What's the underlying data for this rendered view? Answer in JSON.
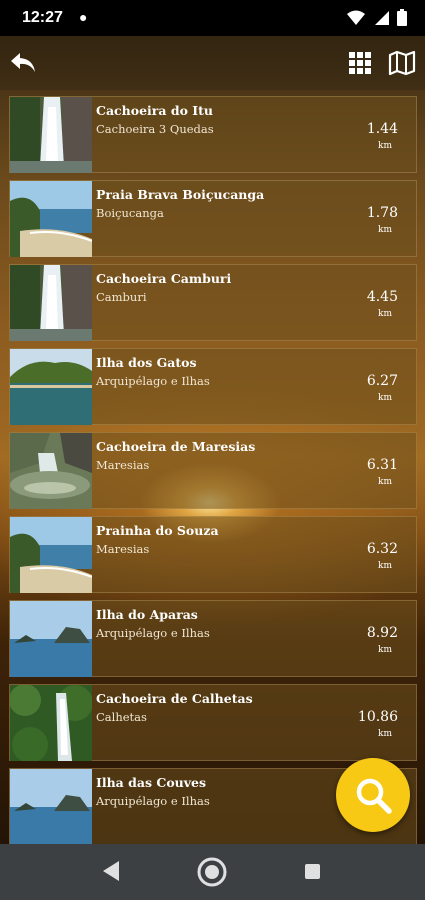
{
  "status_bar": {
    "time": "12:27",
    "icons": [
      "notification-dot-icon",
      "wifi-icon",
      "signal-icon",
      "battery-icon"
    ]
  },
  "app_bar": {
    "icons": [
      "back-arrow-icon",
      "grid-view-icon",
      "map-icon"
    ]
  },
  "places": [
    {
      "name": "Cachoeira do Itu",
      "location": "Cachoeira 3 Quedas",
      "distance": "1.44",
      "unit": "km",
      "thumb": "waterfall"
    },
    {
      "name": "Praia Brava Boiçucanga",
      "location": "Boiçucanga",
      "distance": "1.78",
      "unit": "km",
      "thumb": "beach"
    },
    {
      "name": "Cachoeira Camburi",
      "location": "Camburi",
      "distance": "4.45",
      "unit": "km",
      "thumb": "waterfall"
    },
    {
      "name": "Ilha dos Gatos",
      "location": "Arquipélago e Ilhas",
      "distance": "6.27",
      "unit": "km",
      "thumb": "island"
    },
    {
      "name": "Cachoeira de Maresias",
      "location": "Maresias",
      "distance": "6.31",
      "unit": "km",
      "thumb": "rocks"
    },
    {
      "name": "Prainha do Souza",
      "location": "Maresias",
      "distance": "6.32",
      "unit": "km",
      "thumb": "beach"
    },
    {
      "name": "Ilha do Aparas",
      "location": "Arquipélago e Ilhas",
      "distance": "8.92",
      "unit": "km",
      "thumb": "sea"
    },
    {
      "name": "Cachoeira de Calhetas",
      "location": "Calhetas",
      "distance": "10.86",
      "unit": "km",
      "thumb": "forest"
    },
    {
      "name": "Ilha das Couves",
      "location": "Arquipélago e Ilhas",
      "distance": "",
      "unit": "",
      "thumb": "sea"
    }
  ],
  "fab": {
    "icon": "search-icon"
  },
  "nav_bar": {
    "icons": [
      "nav-back-icon",
      "nav-home-icon",
      "nav-recents-icon"
    ]
  },
  "colors": {
    "fab": "#f7c914",
    "status_bar": "#000000",
    "nav_bar": "#3c4043"
  }
}
